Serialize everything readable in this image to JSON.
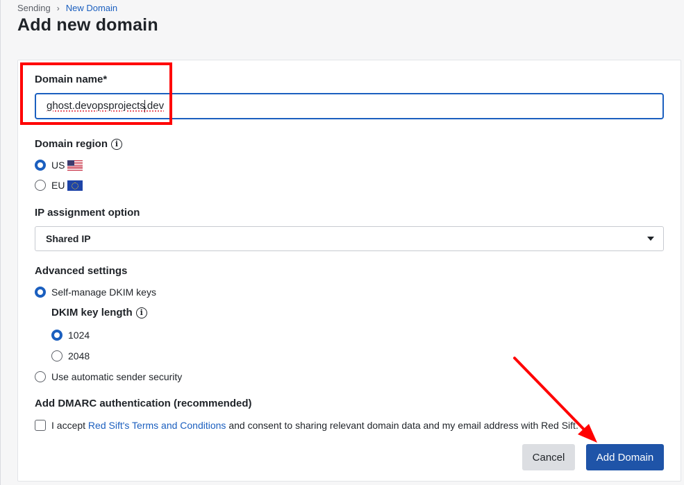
{
  "breadcrumb": {
    "parent": "Sending",
    "separator": "›",
    "current": "New Domain"
  },
  "page": {
    "title": "Add new domain"
  },
  "form": {
    "domain_name": {
      "label": "Domain name*",
      "value_before_caret": "ghost.devopsprojects",
      "value_after_caret": ".dev"
    },
    "domain_region": {
      "label": "Domain region",
      "info_icon": "i",
      "options": [
        {
          "label": "US",
          "flag": "us-flag-icon",
          "selected": true
        },
        {
          "label": "EU",
          "flag": "eu-flag-icon",
          "selected": false
        }
      ]
    },
    "ip_assignment": {
      "label": "IP assignment option",
      "selected": "Shared IP"
    },
    "advanced": {
      "label": "Advanced settings",
      "self_manage": {
        "label": "Self-manage DKIM keys",
        "selected": true
      },
      "dkim_length": {
        "label": "DKIM key length",
        "info_icon": "i",
        "options": [
          {
            "label": "1024",
            "selected": true
          },
          {
            "label": "2048",
            "selected": false
          }
        ]
      },
      "automatic": {
        "label": "Use automatic sender security",
        "selected": false
      }
    },
    "dmarc": {
      "label": "Add DMARC authentication (recommended)",
      "consent_prefix": "I accept ",
      "consent_link": "Red Sift's Terms and Conditions",
      "consent_suffix": " and consent to sharing relevant domain data and my email address with Red Sift.",
      "checked": false
    }
  },
  "actions": {
    "cancel": "Cancel",
    "submit": "Add Domain"
  },
  "colors": {
    "accent": "#1b5fbf",
    "primary_button": "#1f54a8",
    "annotation": "#ff0000"
  }
}
